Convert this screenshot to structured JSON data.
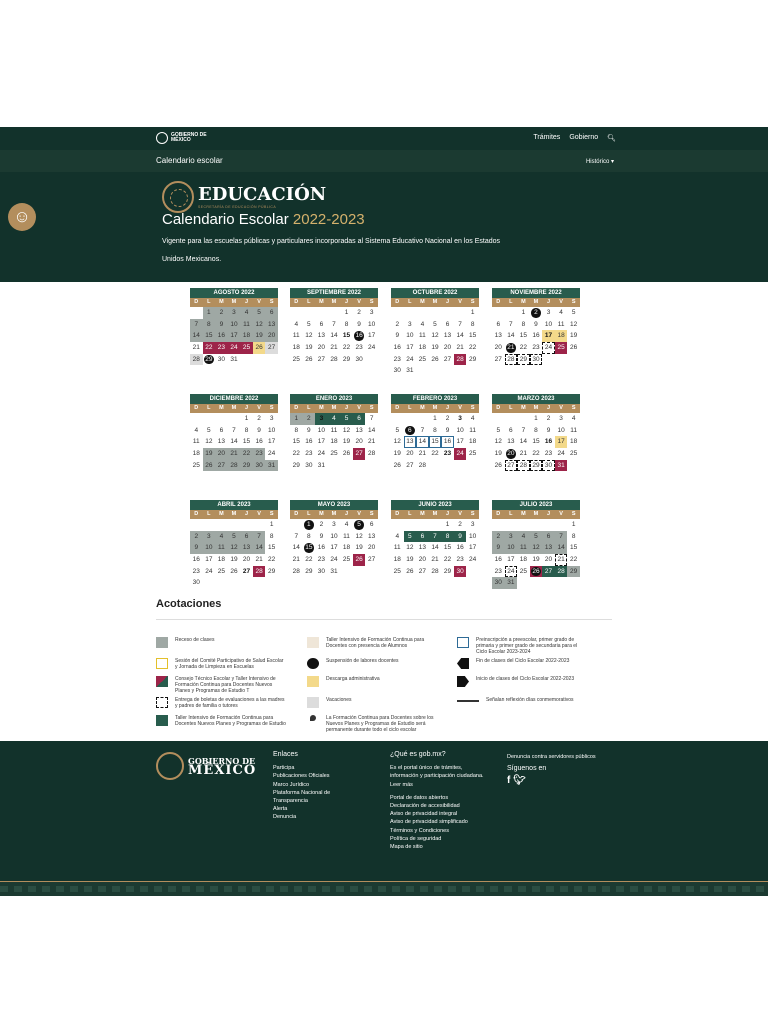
{
  "topnav": {
    "logo_line1": "GOBIERNO DE",
    "logo_line2": "MÉXICO",
    "links": [
      "Trámites",
      "Gobierno"
    ]
  },
  "subnav": {
    "title": "Calendario escolar",
    "historico": "Histórico ▾"
  },
  "hero": {
    "brand": "EDUCACIÓN",
    "brand_sub": "SECRETARÍA DE EDUCACIÓN PÚBLICA",
    "title": "Calendario Escolar",
    "year": "2022-2023",
    "description": "Vigente para las escuelas públicas y particulares incorporadas al Sistema Educativo Nacional en los Estados Unidos Mexicanos."
  },
  "weekday_labels": [
    "D",
    "L",
    "M",
    "M",
    "J",
    "V",
    "S"
  ],
  "months": [
    {
      "name": "AGOSTO 2022",
      "start": 1,
      "days": 31
    },
    {
      "name": "SEPTIEMBRE 2022",
      "start": 4,
      "days": 30
    },
    {
      "name": "OCTUBRE 2022",
      "start": 6,
      "days": 31
    },
    {
      "name": "NOVIEMBRE 2022",
      "start": 2,
      "days": 30
    },
    {
      "name": "DICIEMBRE 2022",
      "start": 4,
      "days": 31
    },
    {
      "name": "ENERO 2023",
      "start": 0,
      "days": 31
    },
    {
      "name": "FEBRERO 2023",
      "start": 3,
      "days": 28
    },
    {
      "name": "MARZO 2023",
      "start": 3,
      "days": 31
    },
    {
      "name": "ABRIL 2023",
      "start": 6,
      "days": 30
    },
    {
      "name": "MAYO 2023",
      "start": 1,
      "days": 31
    },
    {
      "name": "JUNIO 2023",
      "start": 4,
      "days": 30
    },
    {
      "name": "JULIO 2023",
      "start": 6,
      "days": 31
    }
  ],
  "acotaciones_title": "Acotaciones",
  "legend": [
    {
      "text": "Receso de clases",
      "color": "#9fa8a4",
      "icon": "gray-square"
    },
    {
      "text": "Taller Intensivo de Formación Continua para Docentes con presencia de Alumnos",
      "color": "#efe6d8",
      "icon": "cream-square"
    },
    {
      "text": "Preinscripción a preescolar, primer grado de primaria y primer grado de secundaria para el Ciclo Escolar 2023-2024",
      "color": "#2e6b96",
      "icon": "blue-outline-square"
    },
    {
      "text": "Sesión del Comité Participativo de Salud Escolar y Jornada de Limpieza en Escuelas",
      "color": "#e3c02b",
      "icon": "yellow-outline-square"
    },
    {
      "text": "Suspensión de labores docentes",
      "color": "#111111",
      "icon": "black-circle"
    },
    {
      "text": "Fin de clases del Ciclo Escolar 2022-2023",
      "color": "#111111",
      "icon": "arrow-left-shape"
    },
    {
      "text": "Consejo Técnico Escolar y Taller Intensivo de Formación Continua para Docentes Nuevos Planes y Programas de Estudio T",
      "color": "#9d2449",
      "icon": "red-green-square"
    },
    {
      "text": "Descarga administrativa",
      "color": "#f3d98a",
      "icon": "yellow-square"
    },
    {
      "text": "Inicio de clases del Ciclo Escolar 2022-2023",
      "color": "#111111",
      "icon": "arrow-right-shape"
    },
    {
      "text": "Entrega de boletas de evaluaciones a las madres y padres de familia o tutores",
      "color": "#111111",
      "icon": "dashed-square"
    },
    {
      "text": "Vacaciones",
      "color": "#dcdcdc",
      "icon": "light-gray-square"
    },
    {
      "text": "Señalan reflexión días conmemorativos",
      "color": "#333333",
      "icon": "efemerides-label"
    },
    {
      "text": "Taller Intensivo de Formación Continua para Docentes Nuevos Planes y Programas de Estudio",
      "color": "#285c4d",
      "icon": "green-square"
    },
    {
      "text": "La Formación Continua para Docentes sobre los Nuevos Planes y Programas de Estudio será permanente durante todo el ciclo escolar",
      "color": "#333333",
      "icon": "pin-icon"
    }
  ],
  "footer": {
    "logo_line1": "GOBIERNO DE",
    "logo_line2": "MÉXICO",
    "enlaces_title": "Enlaces",
    "enlaces": [
      "Participa",
      "Publicaciones Oficiales",
      "Marco Jurídico",
      "Plataforma Nacional de Transparencia",
      "Alerta",
      "Denuncia"
    ],
    "que_es_title": "¿Qué es gob.mx?",
    "que_es_text": "Es el portal único de trámites, información y participación ciudadana. Leer más",
    "que_es_links": [
      "Portal de datos abiertos",
      "Declaración de accesibilidad",
      "Aviso de privacidad integral",
      "Aviso de privacidad simplificado",
      "Términos y Condiciones",
      "Política de seguridad",
      "Mapa de sitio"
    ],
    "denuncia": "Denuncia contra servidores públicos",
    "siguenos": "Síguenos en"
  }
}
